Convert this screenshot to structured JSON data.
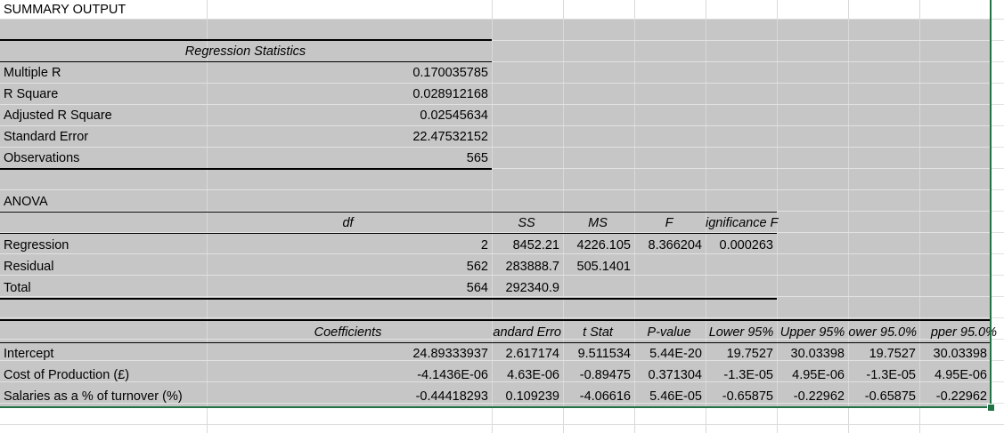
{
  "sheet": {
    "title": "SUMMARY OUTPUT",
    "regression_statistics": {
      "header": "Regression Statistics",
      "rows": [
        {
          "label": "Multiple R",
          "value": "0.170035785"
        },
        {
          "label": "R Square",
          "value": "0.028912168"
        },
        {
          "label": "Adjusted R Square",
          "value": "0.02545634"
        },
        {
          "label": "Standard Error",
          "value": "22.47532152"
        },
        {
          "label": "Observations",
          "value": "565"
        }
      ]
    },
    "anova": {
      "title": "ANOVA",
      "headers": [
        "df",
        "SS",
        "MS",
        "F",
        "ignificance F"
      ],
      "rows": [
        {
          "label": "Regression",
          "df": "2",
          "ss": "8452.21",
          "ms": "4226.105",
          "f": "8.366204",
          "sig": "0.000263"
        },
        {
          "label": "Residual",
          "df": "562",
          "ss": "283888.7",
          "ms": "505.1401",
          "f": "",
          "sig": ""
        },
        {
          "label": "Total",
          "df": "564",
          "ss": "292340.9",
          "ms": "",
          "f": "",
          "sig": ""
        }
      ]
    },
    "coefficients": {
      "headers": [
        "Coefficients",
        "andard Erro",
        "t Stat",
        "P-value",
        "Lower 95%",
        "Upper 95%",
        "ower 95.0%",
        "pper 95.0%"
      ],
      "rows": [
        {
          "label": "Intercept",
          "values": [
            "24.89333937",
            "2.617174",
            "9.511534",
            "5.44E-20",
            "19.7527",
            "30.03398",
            "19.7527",
            "30.03398"
          ]
        },
        {
          "label": "Cost of Production (£)",
          "values": [
            "-4.1436E-06",
            "4.63E-06",
            "-0.89475",
            "0.371304",
            "-1.3E-05",
            "4.95E-06",
            "-1.3E-05",
            "4.95E-06"
          ]
        },
        {
          "label": "Salaries as a % of turnover (%)",
          "values": [
            "-0.44418293",
            "0.109239",
            "-4.06616",
            "5.46E-05",
            "-0.65875",
            "-0.22962",
            "-0.65875",
            "-0.22962"
          ]
        }
      ]
    }
  }
}
